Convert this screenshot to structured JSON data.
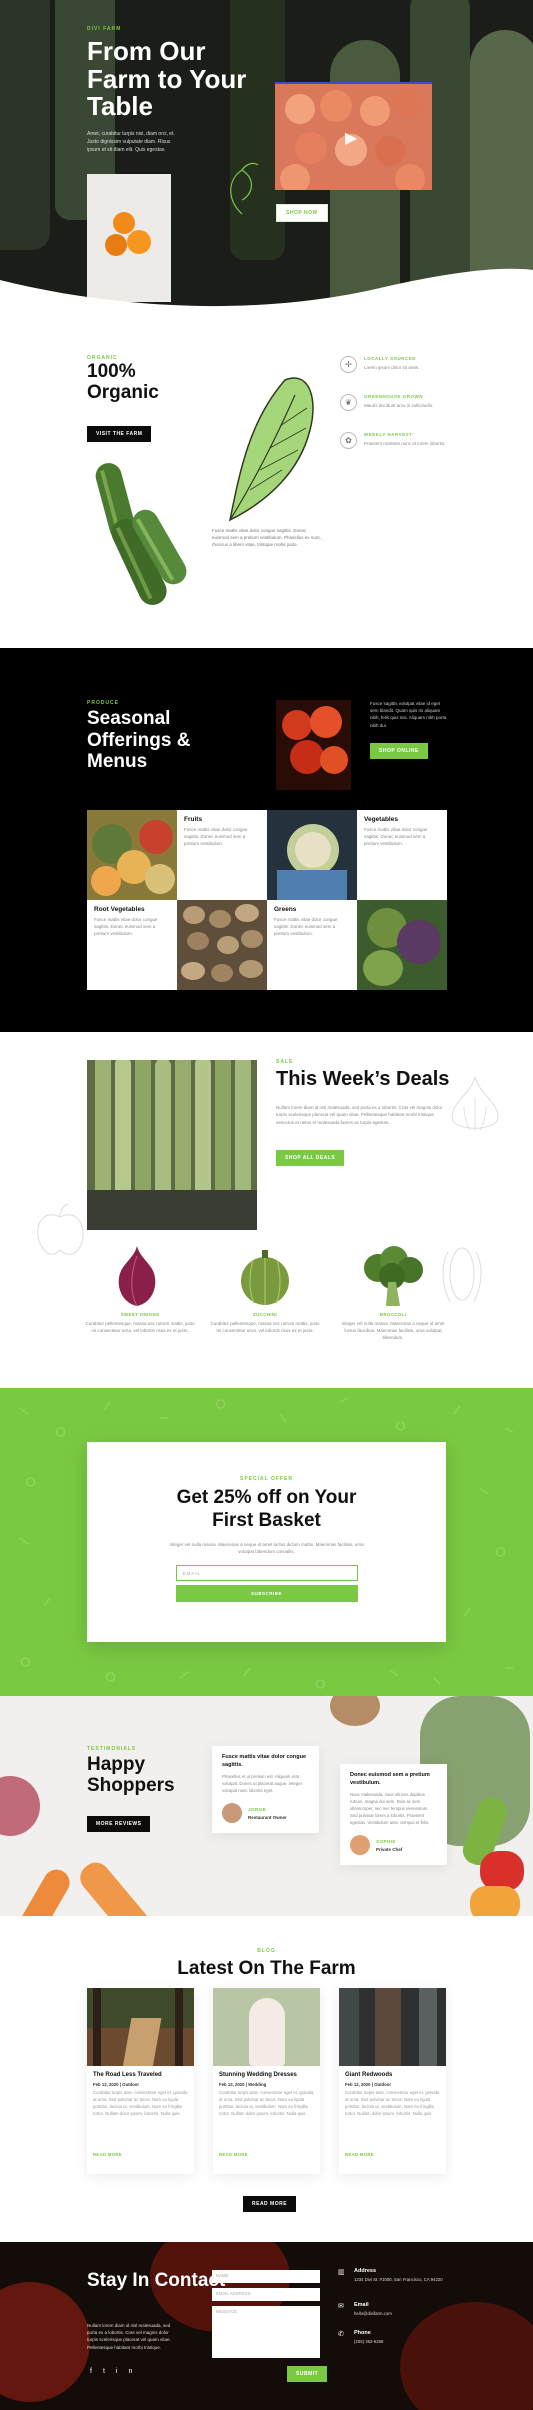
{
  "hero": {
    "eyebrow": "DIVI FARM",
    "title": "From Our Farm to Your Table",
    "lead": "Amet, curabitur turpis nisi, diam orci, et. Justo dignissim vulputate diam. Risus ipsum et sit diam elit. Quis egestas.",
    "shop_button": "SHOP NOW"
  },
  "organic": {
    "eyebrow": "ORGANIC",
    "title": "100% Organic",
    "button": "VISIT THE FARM",
    "body": "Fusce mattis vitae dolor congue sagittis. Donec euismod sem a pretium vestibulum. Phasellus ex nunc, rhoncus a libero vitae, tristique mollis justo.",
    "features": [
      {
        "title": "LOCALLY SOURCED",
        "text": "Lorem ipsum dolor sit amet.",
        "icon": "windmill-icon"
      },
      {
        "title": "GREENHOUSE GROWN",
        "text": "Mauris tincidunt arcu in sollicitudin.",
        "icon": "leaf-icon"
      },
      {
        "title": "WEEKLY HARVEST",
        "text": "Praesent molestie nunc et lorem lobortis.",
        "icon": "sprout-icon"
      }
    ]
  },
  "seasonal": {
    "eyebrow": "PRODUCE",
    "title": "Seasonal Offerings & Menus",
    "desc": "Fusce sagittis volutpat vitae id eget sem blandit. Quam quis mi aliquam nibh, felis quis nisi. Aliquam nibh porta nibh dui.",
    "button": "SHOP ONLINE",
    "cells": [
      {
        "title": "Fruits",
        "text": "Fusce mattis vitae dolor congue sagittis. Donec euismod sem a pretium vestibulum."
      },
      {
        "title": "Vegetables",
        "text": "Fusce mattis vitae dolor congue sagittis. Donec euismod sem a pretium vestibulum."
      },
      {
        "title": "Root Vegetables",
        "text": "Fusce mattis vitae dolor congue sagittis. Donec euismod sem a pretium vestibulum."
      },
      {
        "title": "Greens",
        "text": "Fusce mattis vitae dolor congue sagittis. Donec euismod sem a pretium vestibulum."
      }
    ]
  },
  "deals": {
    "eyebrow": "SALE",
    "title": "This Week’s Deals",
    "desc": "Nullam lorem diam id nisl malesuada, sed porta ex a lobortis. Cras vel magnis dolor turpis scelerisque placerat vel quam vitae. Pellentesque habitant morbi tristique senectus et netus et malesuada fames ac turpis egestas.",
    "button": "SHOP ALL DEALS",
    "products": [
      {
        "name": "SWEET ONIONS",
        "text": "Curabitur pellentesque, massa nec rutrum mattis, justo mi consectetur urna, vel lobortis risus ex et justo."
      },
      {
        "name": "ZUCCHINI",
        "text": "Curabitur pellentesque, massa nec rutrum mattis, justo mi consectetur urna, vel lobortis risus ex et justo."
      },
      {
        "name": "BROCCOLI",
        "text": "Integer vel nulla massa. Maecenas a neque id amet luctus faucibus. Maecenas facilisis, urna volutpat bibendum."
      }
    ]
  },
  "offer": {
    "eyebrow": "SPECIAL OFFER",
    "title": "Get 25% off on Your First Basket",
    "desc": "Integer vel nulla massa. Maecenas a neque id amet luctus dictum mattis. Maecenas facilisis, urna volutpat bibendum convallis.",
    "email_placeholder": "EMAIL",
    "subscribe": "SUBSCRIBE"
  },
  "testimonials": {
    "eyebrow": "TESTIMONIALS",
    "title": "Happy Shoppers",
    "button": "MORE REVIEWS",
    "cards": [
      {
        "quote": "Fusce mattis vitae dolor congue sagittis.",
        "text": "Phasellus et ut pretium est. Aliquam erat volutpat. Donec ut placerat augue. Integer volutpat nunc lobortis eget.",
        "name": "JORGE",
        "role": "Restaurant Owner"
      },
      {
        "quote": "Donec euismod sem a pretium vestibulum.",
        "text": "Nunc malesuada, risus ultrices dapibus rutrum, magna dui sem. Duis ac sem ullamcorper, nec nec tempus elementum. Sed pulvinar lorem a lobortis. Praesent egestas. Vestibulum ante, tempus et felis.",
        "name": "SOPHIE",
        "role": "Private Chef"
      }
    ]
  },
  "blog": {
    "eyebrow": "BLOG",
    "title": "Latest On The Farm",
    "button": "READ MORE",
    "posts": [
      {
        "title": "The Road Less Traveled",
        "meta": "Feb 12, 2020 | Outdoor",
        "excerpt": "Curabitur turpis ante, consectetur eget et, gravida at urna. Sed pulvinar ac lacus. Nam eu ligula porttitor, lacinia ut, vestibulum. Nam eu fringilla tortor. Nullam dolor ipsum, lobortis. Nulla quis.",
        "more": "READ MORE"
      },
      {
        "title": "Stunning Wedding Dresses",
        "meta": "Feb 12, 2020 | Wedding",
        "excerpt": "Curabitur turpis ante, consectetur eget et, gravida at urna. Sed pulvinar ac lacus. Nam eu ligula porttitor, lacinia ut, vestibulum. Nam eu fringilla tortor. Nullam dolor ipsum, lobortis. Nulla quis.",
        "more": "READ MORE"
      },
      {
        "title": "Giant Redwoods",
        "meta": "Feb 12, 2020 | Outdoor",
        "excerpt": "Curabitur turpis ante, consectetur eget et, gravida at urna. Sed pulvinar ac lacus. Nam eu ligula porttitor, lacinia ut, vestibulum. Nam eu fringilla tortor. Nullam dolor ipsum, lobortis. Nulla quis.",
        "more": "READ MORE"
      }
    ]
  },
  "contact": {
    "title": "Stay In Contact",
    "desc": "Nullam lorem diam id nisl malesuada, sed porta ex a lobortis. Cras vel magnis dolor turpis scelerisque placerat vel quam vitae. Pellentesque habitant morbi tristique.",
    "name_placeholder": "NAME",
    "email_placeholder": "EMAIL ADDRESS",
    "message_placeholder": "MESSAGE",
    "submit": "SUBMIT",
    "address_label": "Address",
    "address": "1234 Divi St. #1000, San Francisco, CA 94220",
    "email_label": "Email",
    "email": "hello@divifarm.com",
    "phone_label": "Phone",
    "phone": "(255) 352-6258",
    "social": [
      "f",
      "t",
      "in"
    ]
  },
  "colors": {
    "accent": "#7ac943",
    "dark": "#0b0b0b"
  }
}
